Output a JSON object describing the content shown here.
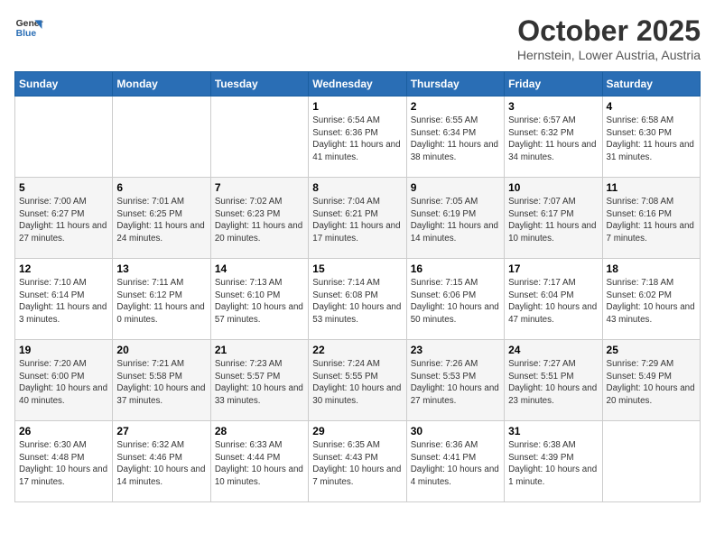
{
  "logo": {
    "line1": "General",
    "line2": "Blue"
  },
  "title": "October 2025",
  "location": "Hernstein, Lower Austria, Austria",
  "weekdays": [
    "Sunday",
    "Monday",
    "Tuesday",
    "Wednesday",
    "Thursday",
    "Friday",
    "Saturday"
  ],
  "weeks": [
    [
      {
        "day": "",
        "sunrise": "",
        "sunset": "",
        "daylight": ""
      },
      {
        "day": "",
        "sunrise": "",
        "sunset": "",
        "daylight": ""
      },
      {
        "day": "",
        "sunrise": "",
        "sunset": "",
        "daylight": ""
      },
      {
        "day": "1",
        "sunrise": "Sunrise: 6:54 AM",
        "sunset": "Sunset: 6:36 PM",
        "daylight": "Daylight: 11 hours and 41 minutes."
      },
      {
        "day": "2",
        "sunrise": "Sunrise: 6:55 AM",
        "sunset": "Sunset: 6:34 PM",
        "daylight": "Daylight: 11 hours and 38 minutes."
      },
      {
        "day": "3",
        "sunrise": "Sunrise: 6:57 AM",
        "sunset": "Sunset: 6:32 PM",
        "daylight": "Daylight: 11 hours and 34 minutes."
      },
      {
        "day": "4",
        "sunrise": "Sunrise: 6:58 AM",
        "sunset": "Sunset: 6:30 PM",
        "daylight": "Daylight: 11 hours and 31 minutes."
      }
    ],
    [
      {
        "day": "5",
        "sunrise": "Sunrise: 7:00 AM",
        "sunset": "Sunset: 6:27 PM",
        "daylight": "Daylight: 11 hours and 27 minutes."
      },
      {
        "day": "6",
        "sunrise": "Sunrise: 7:01 AM",
        "sunset": "Sunset: 6:25 PM",
        "daylight": "Daylight: 11 hours and 24 minutes."
      },
      {
        "day": "7",
        "sunrise": "Sunrise: 7:02 AM",
        "sunset": "Sunset: 6:23 PM",
        "daylight": "Daylight: 11 hours and 20 minutes."
      },
      {
        "day": "8",
        "sunrise": "Sunrise: 7:04 AM",
        "sunset": "Sunset: 6:21 PM",
        "daylight": "Daylight: 11 hours and 17 minutes."
      },
      {
        "day": "9",
        "sunrise": "Sunrise: 7:05 AM",
        "sunset": "Sunset: 6:19 PM",
        "daylight": "Daylight: 11 hours and 14 minutes."
      },
      {
        "day": "10",
        "sunrise": "Sunrise: 7:07 AM",
        "sunset": "Sunset: 6:17 PM",
        "daylight": "Daylight: 11 hours and 10 minutes."
      },
      {
        "day": "11",
        "sunrise": "Sunrise: 7:08 AM",
        "sunset": "Sunset: 6:16 PM",
        "daylight": "Daylight: 11 hours and 7 minutes."
      }
    ],
    [
      {
        "day": "12",
        "sunrise": "Sunrise: 7:10 AM",
        "sunset": "Sunset: 6:14 PM",
        "daylight": "Daylight: 11 hours and 3 minutes."
      },
      {
        "day": "13",
        "sunrise": "Sunrise: 7:11 AM",
        "sunset": "Sunset: 6:12 PM",
        "daylight": "Daylight: 11 hours and 0 minutes."
      },
      {
        "day": "14",
        "sunrise": "Sunrise: 7:13 AM",
        "sunset": "Sunset: 6:10 PM",
        "daylight": "Daylight: 10 hours and 57 minutes."
      },
      {
        "day": "15",
        "sunrise": "Sunrise: 7:14 AM",
        "sunset": "Sunset: 6:08 PM",
        "daylight": "Daylight: 10 hours and 53 minutes."
      },
      {
        "day": "16",
        "sunrise": "Sunrise: 7:15 AM",
        "sunset": "Sunset: 6:06 PM",
        "daylight": "Daylight: 10 hours and 50 minutes."
      },
      {
        "day": "17",
        "sunrise": "Sunrise: 7:17 AM",
        "sunset": "Sunset: 6:04 PM",
        "daylight": "Daylight: 10 hours and 47 minutes."
      },
      {
        "day": "18",
        "sunrise": "Sunrise: 7:18 AM",
        "sunset": "Sunset: 6:02 PM",
        "daylight": "Daylight: 10 hours and 43 minutes."
      }
    ],
    [
      {
        "day": "19",
        "sunrise": "Sunrise: 7:20 AM",
        "sunset": "Sunset: 6:00 PM",
        "daylight": "Daylight: 10 hours and 40 minutes."
      },
      {
        "day": "20",
        "sunrise": "Sunrise: 7:21 AM",
        "sunset": "Sunset: 5:58 PM",
        "daylight": "Daylight: 10 hours and 37 minutes."
      },
      {
        "day": "21",
        "sunrise": "Sunrise: 7:23 AM",
        "sunset": "Sunset: 5:57 PM",
        "daylight": "Daylight: 10 hours and 33 minutes."
      },
      {
        "day": "22",
        "sunrise": "Sunrise: 7:24 AM",
        "sunset": "Sunset: 5:55 PM",
        "daylight": "Daylight: 10 hours and 30 minutes."
      },
      {
        "day": "23",
        "sunrise": "Sunrise: 7:26 AM",
        "sunset": "Sunset: 5:53 PM",
        "daylight": "Daylight: 10 hours and 27 minutes."
      },
      {
        "day": "24",
        "sunrise": "Sunrise: 7:27 AM",
        "sunset": "Sunset: 5:51 PM",
        "daylight": "Daylight: 10 hours and 23 minutes."
      },
      {
        "day": "25",
        "sunrise": "Sunrise: 7:29 AM",
        "sunset": "Sunset: 5:49 PM",
        "daylight": "Daylight: 10 hours and 20 minutes."
      }
    ],
    [
      {
        "day": "26",
        "sunrise": "Sunrise: 6:30 AM",
        "sunset": "Sunset: 4:48 PM",
        "daylight": "Daylight: 10 hours and 17 minutes."
      },
      {
        "day": "27",
        "sunrise": "Sunrise: 6:32 AM",
        "sunset": "Sunset: 4:46 PM",
        "daylight": "Daylight: 10 hours and 14 minutes."
      },
      {
        "day": "28",
        "sunrise": "Sunrise: 6:33 AM",
        "sunset": "Sunset: 4:44 PM",
        "daylight": "Daylight: 10 hours and 10 minutes."
      },
      {
        "day": "29",
        "sunrise": "Sunrise: 6:35 AM",
        "sunset": "Sunset: 4:43 PM",
        "daylight": "Daylight: 10 hours and 7 minutes."
      },
      {
        "day": "30",
        "sunrise": "Sunrise: 6:36 AM",
        "sunset": "Sunset: 4:41 PM",
        "daylight": "Daylight: 10 hours and 4 minutes."
      },
      {
        "day": "31",
        "sunrise": "Sunrise: 6:38 AM",
        "sunset": "Sunset: 4:39 PM",
        "daylight": "Daylight: 10 hours and 1 minute."
      },
      {
        "day": "",
        "sunrise": "",
        "sunset": "",
        "daylight": ""
      }
    ]
  ]
}
